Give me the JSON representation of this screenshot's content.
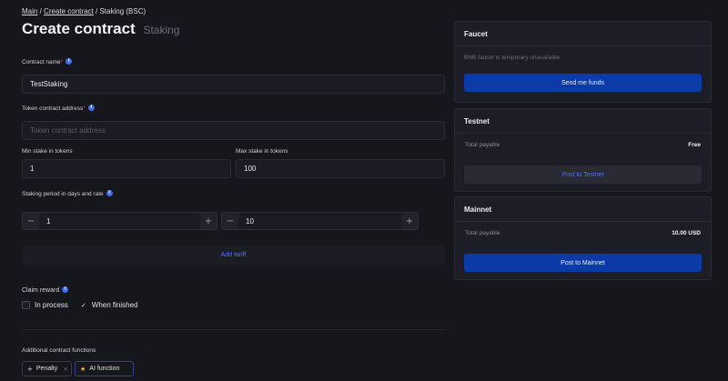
{
  "breadcrumb": {
    "main": "Main",
    "create": "Create contract",
    "current": "Staking (BSC)",
    "sep": "/"
  },
  "page": {
    "title": "Create contract",
    "subtitle": "Staking"
  },
  "form": {
    "contract_name": {
      "label": "Contract name",
      "required": "*",
      "value": "TestStaking"
    },
    "token_address": {
      "label": "Token contract address",
      "required": "*",
      "placeholder": "Token contract address"
    },
    "min_stake": {
      "label": "Min stake in tokens",
      "value": "1"
    },
    "max_stake": {
      "label": "Max stake in tokens",
      "value": "100"
    },
    "staking_period": {
      "label": "Staking period in days and rate",
      "days": "1",
      "rate": "10",
      "minus": "−",
      "plus": "+"
    },
    "add_tariff": "Add tariff",
    "claim_reward": {
      "label": "Claim reward",
      "options": [
        "In process",
        "When finished"
      ],
      "selected": "When finished"
    },
    "additional": {
      "label": "Additional contract functions",
      "chips": [
        {
          "label": "Penalty",
          "icon": "plus-icon"
        },
        {
          "label": "AI function",
          "icon": "star-icon"
        }
      ]
    }
  },
  "faucet": {
    "title": "Faucet",
    "message": "BNB faucet is temporary unavailable",
    "button": "Send me funds"
  },
  "testnet": {
    "title": "Testnet",
    "payable_label": "Total payable",
    "payable_value": "Free",
    "button": "Post to Testnet"
  },
  "mainnet": {
    "title": "Mainnet",
    "payable_label": "Total payable",
    "payable_value": "10.00 USD",
    "button": "Post to Mainnet"
  },
  "colors": {
    "accent": "#0c3aa6",
    "link": "#4d74e8",
    "background": "#16161d",
    "required": "#e0453a"
  }
}
